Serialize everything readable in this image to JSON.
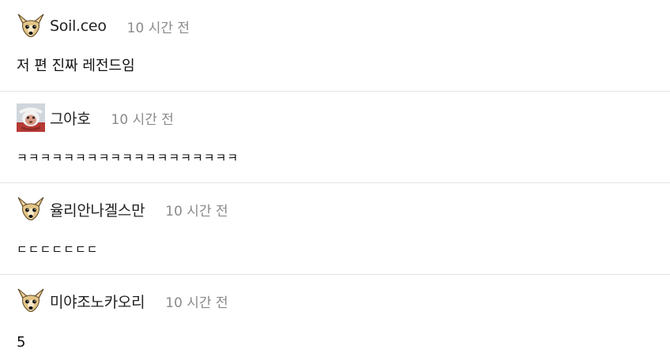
{
  "comments": [
    {
      "author": "Soil.ceo",
      "time": "10 시간 전",
      "text": "저 편 진짜 레전드임",
      "avatar": "chihuahua-icon"
    },
    {
      "author": "그아호",
      "time": "10 시간 전",
      "text": "ㅋㅋㅋㅋㅋㅋㅋㅋㅋㅋㅋㅋㅋㅋㅋㅋㅋㅋㅋ",
      "avatar": "monkey-santa-icon"
    },
    {
      "author": "율리안나겔스만",
      "time": "10 시간 전",
      "text": "ㄷㄷㄷㄷㄷㄷㄷ",
      "avatar": "chihuahua-icon"
    },
    {
      "author": "미야조노카오리",
      "time": "10 시간 전",
      "text": "5",
      "avatar": "chihuahua-icon"
    }
  ]
}
